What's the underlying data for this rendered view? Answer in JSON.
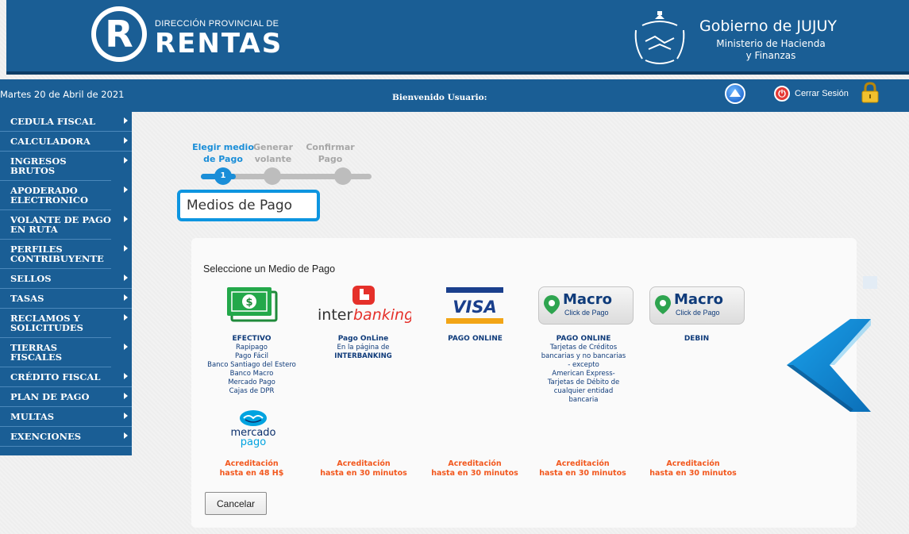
{
  "header": {
    "brand_small": "DIRECCIÓN PROVINCIAL DE",
    "brand_big": "RENTAS",
    "logo_letter": "R",
    "gov_title": "Gobierno de JUJUY",
    "gov_sub_line1": "Ministerio de Hacienda",
    "gov_sub_line2": "y Finanzas"
  },
  "user_bar": {
    "date": "Martes 20 de Abril de 2021",
    "welcome": "Bienvenido Usuario:",
    "logout_label": "Cerrar Sesión"
  },
  "sidebar": {
    "items": [
      {
        "label": "CEDULA FISCAL"
      },
      {
        "label": "CALCULADORA"
      },
      {
        "label": "INGRESOS BRUTOS"
      },
      {
        "label": "APODERADO ELECTRONICO"
      },
      {
        "label": "VOLANTE DE PAGO EN RUTA"
      },
      {
        "label": "PERFILES CONTRIBUYENTE"
      },
      {
        "label": "SELLOS"
      },
      {
        "label": "TASAS"
      },
      {
        "label": "RECLAMOS Y SOLICITUDES"
      },
      {
        "label": "TIERRAS FISCALES"
      },
      {
        "label": "CRÉDITO FISCAL"
      },
      {
        "label": "PLAN DE PAGO"
      },
      {
        "label": "MULTAS"
      },
      {
        "label": "EXENCIONES"
      }
    ]
  },
  "stepper": {
    "steps": [
      {
        "line1": "Elegir medio",
        "line2": "de Pago"
      },
      {
        "line1": "Generar",
        "line2": "volante"
      },
      {
        "line1": "Confirmar",
        "line2": "Pago"
      }
    ],
    "current_step_number": "1"
  },
  "section_title": "Medios de Pago",
  "payment": {
    "prompt": "Seleccione un Medio de Pago",
    "options": [
      {
        "title": "EFECTIVO",
        "desc": [
          "Rapipago",
          "Pago Fácil",
          "Banco Santiago del Estero",
          "Banco Macro",
          "Mercado Pago",
          "Cajas de DPR"
        ],
        "accred_line1": "Acreditación",
        "accred_line2": "hasta en 48 H$"
      },
      {
        "title": "Pago OnLine",
        "desc": [
          "En la página de",
          "INTERBANKING"
        ],
        "accred_line1": "Acreditación",
        "accred_line2": "hasta en 30 minutos"
      },
      {
        "title": "PAGO ONLINE",
        "desc": [],
        "accred_line1": "Acreditación",
        "accred_line2": "hasta en 30 minutos"
      },
      {
        "title": "PAGO ONLINE",
        "desc": [
          "Tarjetas de Créditos",
          "bancarias y no bancarias",
          "- excepto",
          "American Express-",
          "Tarjetas de Débito de",
          "cualquier entidad",
          "bancaria"
        ],
        "accred_line1": "Acreditación",
        "accred_line2": "hasta en 30 minutos"
      },
      {
        "title": "DEBIN",
        "desc": [],
        "accred_line1": "Acreditación",
        "accred_line2": "hasta en 30 minutos"
      }
    ],
    "logos": {
      "interbanking_a": "inter",
      "interbanking_b": "banking",
      "visa": "VISA",
      "macro": "Macro",
      "macro_sub": "Click de Pago",
      "mp_line1": "mercado",
      "mp_line2": "pago",
      "cash_symbol": "$"
    },
    "cancel_label": "Cancelar"
  },
  "colors": {
    "primary_blue": "#1a5e95",
    "accent_blue": "#1a8ed8",
    "accred_orange": "#f2581e",
    "text_navy": "#0f3b7a"
  }
}
